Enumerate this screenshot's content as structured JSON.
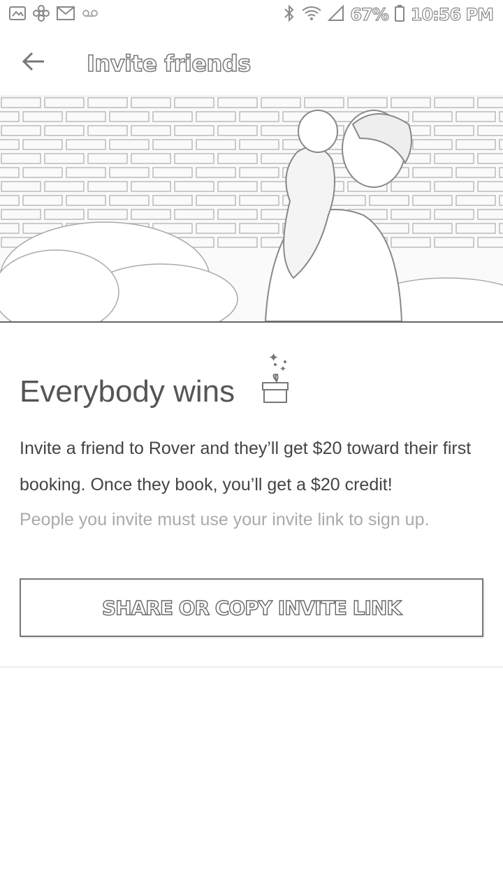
{
  "status_bar": {
    "left_icons": [
      "image-icon",
      "pinwheel-icon",
      "gmail-icon",
      "voicemail-icon"
    ],
    "right_icons": [
      "bluetooth-icon",
      "wifi-icon",
      "signal-icon",
      "battery-icon"
    ],
    "battery": "67%",
    "time": "10:56 PM"
  },
  "app_bar": {
    "back_icon": "arrow-left-icon",
    "title": "Invite friends"
  },
  "hero": {
    "icon": "hero-photo"
  },
  "content": {
    "headline": "Everybody wins",
    "headline_icon": "gift-icon",
    "body": "Invite a friend to Rover and they’ll get $20 toward their first booking. Once they book, you’ll get a $20 credit!",
    "hint": "People you invite must use your invite link to sign up.",
    "share_button": "SHARE OR COPY INVITE LINK"
  }
}
